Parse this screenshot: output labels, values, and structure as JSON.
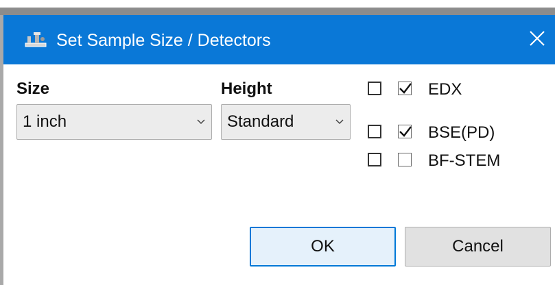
{
  "window": {
    "title": "Set Sample Size / Detectors",
    "title_icon": "microscope-stage-icon",
    "close_icon": "close-icon"
  },
  "size": {
    "label": "Size",
    "selected": "1 inch"
  },
  "height": {
    "label": "Height",
    "selected": "Standard"
  },
  "detectors": [
    {
      "label": "EDX",
      "outer_checked": false,
      "inner_checked": true
    },
    {
      "label": "BSE(PD)",
      "outer_checked": false,
      "inner_checked": true
    },
    {
      "label": "BF-STEM",
      "outer_checked": false,
      "inner_checked": false
    }
  ],
  "buttons": {
    "ok": "OK",
    "cancel": "Cancel"
  },
  "colors": {
    "titlebar": "#0a78d7",
    "ok_border": "#0078d7"
  }
}
